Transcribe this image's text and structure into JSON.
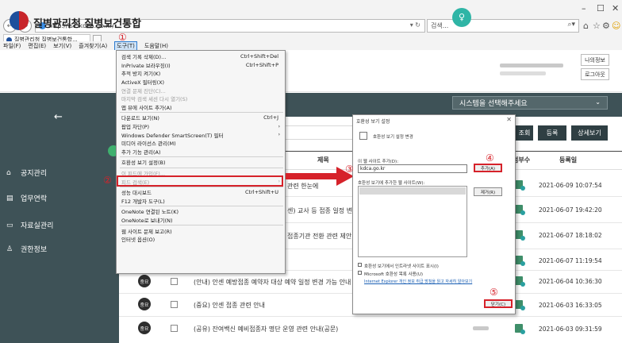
{
  "browser": {
    "url": "http://is1.kdca.go.kr/",
    "addr_controls": "▾ ↻",
    "search_placeholder": "검색...",
    "search_icon": "⌕▾",
    "tab_title": "질병관리청 질병보건통합...",
    "window_controls": [
      "–",
      "☐",
      "✕"
    ],
    "right_icons": [
      "⌂",
      "☆",
      "⚙",
      "☺"
    ],
    "menubar": [
      "파일(F)",
      "편집(E)",
      "보기(V)",
      "즐겨찾기(A)",
      "도구(T)",
      "도움말(H)"
    ]
  },
  "site": {
    "title": "질병관리청 질병보건통합",
    "user_icon": "♀",
    "my_info": "나의정보",
    "logout": "로그아웃",
    "system_select": "시스템을 선택해주세요",
    "buttons": {
      "search": "조회",
      "register": "등록",
      "detail": "상세보기"
    }
  },
  "sidebar": {
    "collapse": "←",
    "items": [
      {
        "icon": "⌂",
        "label": "공지관리"
      },
      {
        "icon": "▤",
        "label": "업무연락"
      },
      {
        "icon": "▭",
        "label": "자료실관리"
      },
      {
        "icon": "♙",
        "label": "권한정보"
      }
    ]
  },
  "table": {
    "headers": {
      "title": "제목",
      "count": "첨부수",
      "date": "등록일"
    },
    "rows": [
      {
        "title": "관련 한눈에",
        "date": "2021-06-09 10:07:54"
      },
      {
        "title": "센) 교사 등 접종 일정 변경",
        "date": "2021-06-07 19:42:20"
      },
      {
        "title": "접종기관 전환 관련 제안내",
        "date": "2021-06-07 18:18:02"
      },
      {
        "title": "",
        "date": "2021-06-07 11:19:54"
      },
      {
        "badge": "중요",
        "title": "(안내) 안센 예방접종 예약자 대상 예약 일정 변경 가능 안내",
        "date": "2021-06-04 10:36:30"
      },
      {
        "badge": "중요",
        "title": "(중요) 안센 접종 관련 안내",
        "date": "2021-06-03 16:33:05"
      },
      {
        "badge": "중요",
        "title": "(공유) 잔여백신 예비접종자 명단 운영 관련 안내(공문)",
        "date": "2021-06-03 09:31:59"
      }
    ]
  },
  "tools_menu": {
    "items": [
      {
        "label": "검색 기록 삭제(D)...",
        "shortcut": "Ctrl+Shift+Del"
      },
      {
        "label": "InPrivate 브라우징(I)",
        "shortcut": "Ctrl+Shift+P"
      },
      {
        "label": "추적 방지 켜기(K)"
      },
      {
        "label": "ActiveX 필터링(X)"
      },
      {
        "label": "연결 문제 진단(C)...",
        "disabled": true
      },
      {
        "label": "마지막 검색 세션 다시 열기(S)",
        "disabled": true
      },
      {
        "label": "앱 뷰에 사이트 추가(A)"
      },
      {
        "sep": true
      },
      {
        "label": "다운로드 보기(N)",
        "shortcut": "Ctrl+J"
      },
      {
        "label": "팝업 차단(P)",
        "arrow": "›"
      },
      {
        "label": "Windows Defender SmartScreen(T) 필터",
        "arrow": "›"
      },
      {
        "label": "미디어 라이선스 관리(M)"
      },
      {
        "label": "추가 기능 관리(A)"
      },
      {
        "sep": true
      },
      {
        "label": "호환성 보기 설정(B)"
      },
      {
        "sep": true
      },
      {
        "label": "이 피드에 가입(F)...",
        "disabled": true
      },
      {
        "label": "피드 검색(E)",
        "disabled": true,
        "arrow": "›"
      },
      {
        "sep": true
      },
      {
        "label": "성능 대시보드",
        "shortcut": "Ctrl+Shift+U"
      },
      {
        "label": "F12 개발자 도구(L)"
      },
      {
        "sep": true
      },
      {
        "label": "OneNote 연결된 노트(K)"
      },
      {
        "label": "OneNote로 보내기(N)"
      },
      {
        "sep": true
      },
      {
        "label": "웹 사이트 문제 보고(R)"
      },
      {
        "label": "인터넷 옵션(O)"
      }
    ]
  },
  "dialog": {
    "title": "호환성 보기 설정",
    "close": "✕",
    "heading": "호환성 보기 설정 변경",
    "add_label": "이 웹 사이트 추가(D):",
    "input_value": "kdca.go.kr",
    "add_button": "추가(A)",
    "list_label": "호환성 보기에 추가한 웹 사이트(W):",
    "remove_button": "제거(R)",
    "checkbox1": "호환성 보기에서 인트라넷 사이트 표시(I)",
    "checkbox2": "Microsoft 호환성 목록 사용(U)",
    "link_text": "Internet Explorer 개인 정보 취급 방침을 읽고 자세히 알아보기",
    "close_button": "닫기(C)"
  },
  "annotations": [
    "①",
    "②",
    "③",
    "④",
    "⑤"
  ],
  "colors": {
    "accent_red": "#d6222a",
    "sidebar": "#3e5257",
    "teal": "#2fb5a6"
  }
}
